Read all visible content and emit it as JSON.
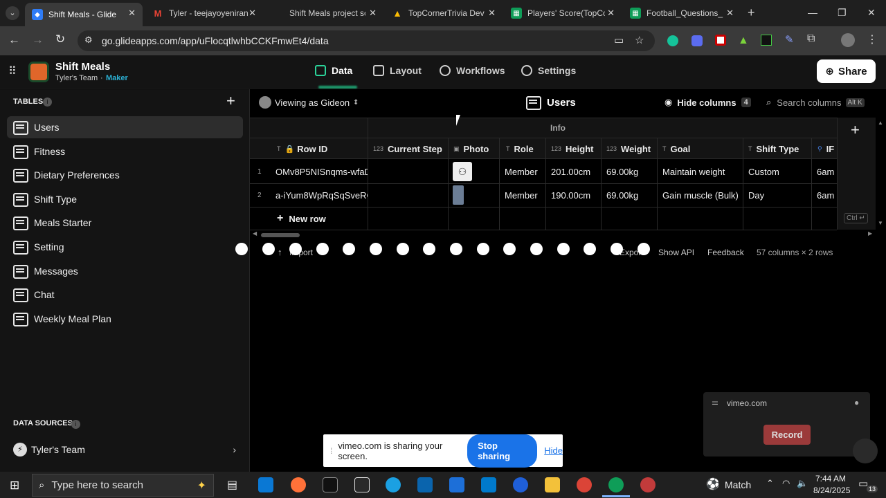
{
  "browser": {
    "tabs": [
      {
        "label": "Shift Meals - Glide",
        "active": true,
        "color": "#2f7cf6"
      },
      {
        "label": "Tyler - teejayoyeniran",
        "active": false,
        "color": "#ea4335"
      },
      {
        "label": "Shift Meals project sc",
        "active": false,
        "color": ""
      },
      {
        "label": "TopCornerTrivia Deve",
        "active": false,
        "color": "#fbbc04"
      },
      {
        "label": "Players' Score(TopCo",
        "active": false,
        "color": "#0f9d58"
      },
      {
        "label": "Football_Questions_",
        "active": false,
        "color": "#0f9d58"
      }
    ],
    "url": "go.glideapps.com/app/uFlocqtlwhbCCKFmwEt4/data"
  },
  "app": {
    "name": "Shift Meals",
    "team": "Tyler's Team",
    "role": "Maker",
    "nav": [
      {
        "label": "Data",
        "active": true
      },
      {
        "label": "Layout",
        "active": false
      },
      {
        "label": "Workflows",
        "active": false
      },
      {
        "label": "Settings",
        "active": false
      }
    ],
    "share_label": "Share"
  },
  "sidebar": {
    "tables_heading": "TABLES",
    "tables": [
      "Users",
      "Fitness",
      "Dietary Preferences",
      "Shift Type",
      "Meals Starter",
      "Setting",
      "Messages",
      "Chat",
      "Weekly Meal Plan"
    ],
    "active_table": "Users",
    "sources_heading": "DATA SOURCES",
    "source": "Tyler's Team"
  },
  "toolbar": {
    "viewing_as": "Viewing as Gideon",
    "table_title": "Users",
    "hide_columns": "Hide columns",
    "hidden_count": "4",
    "search_placeholder": "Search columns",
    "search_shortcut": "Alt K"
  },
  "grid": {
    "group_label": "Info",
    "columns": [
      {
        "type": "T",
        "label": "Row ID",
        "locked": true
      },
      {
        "type": "123",
        "label": "Current Step"
      },
      {
        "type": "img",
        "label": "Photo"
      },
      {
        "type": "T",
        "label": "Role"
      },
      {
        "type": "123",
        "label": "Height"
      },
      {
        "type": "123",
        "label": "Weight"
      },
      {
        "type": "T",
        "label": "Goal"
      },
      {
        "type": "T",
        "label": "Shift Type"
      },
      {
        "type": "",
        "label": "IF"
      }
    ],
    "rows": [
      {
        "num": "1",
        "row_id": "OMv8P5NISnqms-wfaD",
        "current_step": "",
        "role": "Member",
        "height": "201.00cm",
        "weight": "69.00kg",
        "goal": "Maintain weight",
        "shift_type": "Custom",
        "if": "6am"
      },
      {
        "num": "2",
        "row_id": "a-iYum8WpRqSqSveRC",
        "current_step": "",
        "role": "Member",
        "height": "190.00cm",
        "weight": "69.00kg",
        "goal": "Gain muscle (Bulk)",
        "shift_type": "Day",
        "if": "6am"
      }
    ],
    "new_row_label": "New row",
    "shortcut_hint": "Ctrl ↵"
  },
  "footer": {
    "import_label": "Import",
    "export_label": "Export",
    "show_api": "Show API",
    "feedback": "Feedback",
    "summary": "57 columns × 2 rows"
  },
  "vimeo": {
    "domain": "vimeo.com",
    "record": "Record",
    "sharing_text": "vimeo.com is sharing your screen.",
    "stop_sharing": "Stop sharing",
    "hide": "Hide"
  },
  "taskbar": {
    "search_placeholder": "Type here to search",
    "weather": "Match",
    "time": "7:44 AM",
    "date": "8/24/2025",
    "notif_count": "13"
  }
}
